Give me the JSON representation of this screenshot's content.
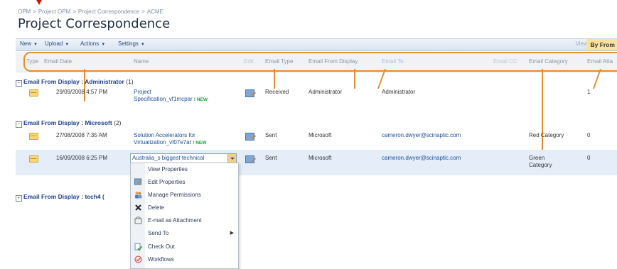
{
  "breadcrumb": [
    "OPM",
    "Project OPM",
    "Project Correspondence",
    "ACME"
  ],
  "breadcrumb_sep": ">",
  "page_title": "Project Correspondence",
  "toolbar": {
    "new": "New",
    "upload": "Upload",
    "actions": "Actions",
    "settings": "Settings",
    "view_label": "View:",
    "view_value": "By From"
  },
  "columns": {
    "type": "Type",
    "email_date": "Email Date",
    "name": "Name",
    "edit": "Edit",
    "email_type": "Email Type",
    "email_from_display": "Email From Display",
    "email_to": "Email To",
    "email_cc": "Email CC",
    "email_category": "Email Category",
    "email_attachments": "Email Atta"
  },
  "groups": [
    {
      "label": "Email From Display : Administrator",
      "count": "(1)",
      "rows": [
        {
          "date": "29/09/2008 4:57 PM",
          "name_line1": "Project",
          "name_line2": "Specification_vf1mcpar",
          "new_tag": "! NEW",
          "type": "Received",
          "from": "Administrator",
          "to": "Administrator",
          "category": "",
          "attachments": "1"
        }
      ]
    },
    {
      "label": "Email From Display : Microsoft",
      "count": "(2)",
      "rows": [
        {
          "date": "27/08/2008 7:35 AM",
          "name_line1": "Solution Accelerators for",
          "name_line2": "Virtualization_vf07e7ar",
          "new_tag": "! NEW",
          "type": "Sent",
          "from": "Microsoft",
          "to": "cameron.dwyer@scinaptic.com",
          "category": "Red Category",
          "attachments": "0"
        },
        {
          "date": "16/09/2008 6:25 PM",
          "name_line1": "Australia_s biggest technical",
          "type": "Sent",
          "from": "Microsoft",
          "to": "cameron.dwyer@scinaptic.com",
          "category_line1": "Green",
          "category_line2": "Category",
          "attachments": "0"
        }
      ]
    },
    {
      "label": "Email From Display : tech4 (",
      "count": ""
    }
  ],
  "context_menu": {
    "items": [
      {
        "label": "View Properties",
        "icon": "none"
      },
      {
        "label": "Edit Properties",
        "icon": "edit-properties-icon"
      },
      {
        "label": "Manage Permissions",
        "icon": "people-icon"
      },
      {
        "label": "Delete",
        "icon": "delete-x-icon"
      },
      {
        "label": "E-mail as Attachment",
        "icon": "email-attachment-icon"
      },
      {
        "label": "Send To",
        "icon": "none",
        "submenu": "▶"
      },
      {
        "label": "Check Out",
        "icon": "check-out-icon"
      },
      {
        "label": "Workflows",
        "icon": "workflows-icon"
      }
    ]
  },
  "colors": {
    "accent_orange": "#e58f2c",
    "link_blue": "#1f4f9a",
    "selected_row": "#e4edf8",
    "view_highlight": "#fbe29c",
    "new_green": "#15a33a",
    "marker_red": "#d10f0f"
  }
}
